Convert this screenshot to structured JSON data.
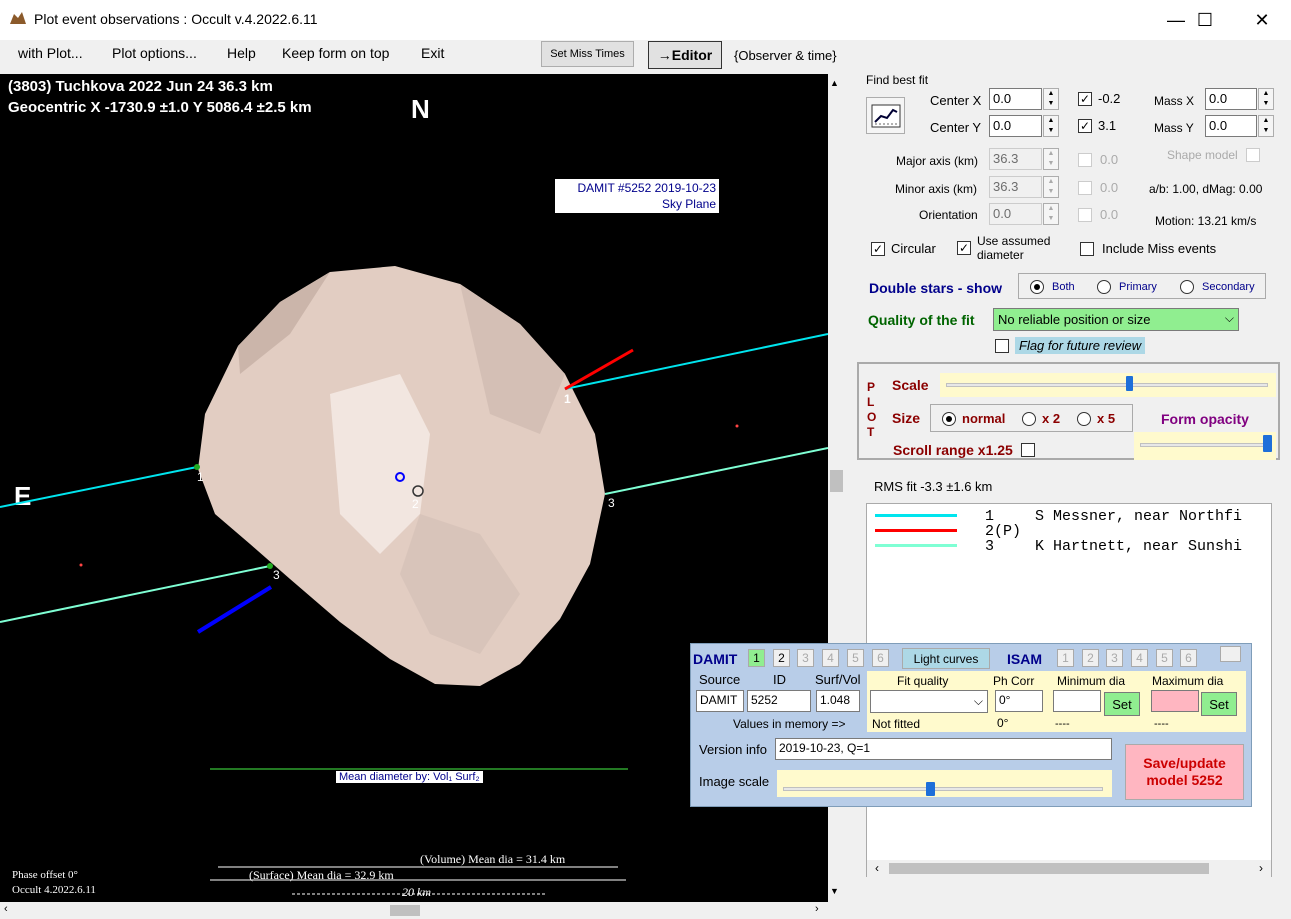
{
  "window": {
    "title": "Plot event observations : Occult v.4.2022.6.11",
    "minimize": "—",
    "maximize": "☐",
    "close": "✕"
  },
  "menu": {
    "with_plot": "with Plot...",
    "plot_options": "Plot options...",
    "help": "Help",
    "keep_on_top": "Keep form on top",
    "exit": "Exit",
    "set_miss_times": "Set Miss Times",
    "editor": "→Editor",
    "observer_time": "{Observer & time}"
  },
  "plot": {
    "header_line1": "(3803) Tuchkova  2022 Jun 24   36.3 km",
    "header_line2": "Geocentric  X  -1730.9 ±1.0  Y 5086.4 ±2.5 km",
    "north": "N",
    "east": "E",
    "damit_label": "DAMIT #5252 2019-10-23",
    "sky_plane": "Sky Plane",
    "chord_labels": [
      "1",
      "1",
      "2",
      "3",
      "3"
    ],
    "mean_diameter_by": "Mean diameter by:  Vol₁  Surf₂",
    "volume_mean": "(Volume) Mean dia = 31.4 km",
    "surface_mean": "(Surface) Mean dia = 32.9 km",
    "scale_20km": "20 km",
    "phase_offset": "Phase offset 0°",
    "version": "Occult 4.2022.6.11"
  },
  "fit": {
    "title": "Find best fit",
    "center_x_label": "Center X",
    "center_x": "0.0",
    "center_y_label": "Center Y",
    "center_y": "0.0",
    "chk_x_val": "-0.2",
    "chk_y_val": "3.1",
    "mass_x_label": "Mass X",
    "mass_x": "0.0",
    "mass_y_label": "Mass Y",
    "mass_y": "0.0",
    "major_label": "Major axis (km)",
    "major": "36.3",
    "minor_label": "Minor axis (km)",
    "minor": "36.3",
    "orient_label": "Orientation",
    "orient": "0.0",
    "zero1": "0.0",
    "zero2": "0.0",
    "zero3": "0.0",
    "shape_model": "Shape model",
    "ab_dmag": "a/b: 1.00, dMag: 0.00",
    "motion": "Motion: 13.21 km/s",
    "circular": "Circular",
    "use_assumed": "Use assumed diameter",
    "include_miss": "Include Miss events",
    "double_stars": "Double stars - show",
    "both": "Both",
    "primary": "Primary",
    "secondary": "Secondary",
    "quality_label": "Quality of the fit",
    "quality_value": "No reliable position or size",
    "flag_review": "Flag for future review"
  },
  "plotpanel": {
    "side_label": [
      "P",
      "L",
      "O",
      "T"
    ],
    "scale": "Scale",
    "size": "Size",
    "normal": "normal",
    "x2": "x 2",
    "x5": "x 5",
    "form_opacity": "Form opacity",
    "scroll_range": "Scroll range x1.25",
    "scale_level": 0.57,
    "opacity_level": 0.98
  },
  "rms": "RMS fit -3.3 ±1.6 km",
  "legend": [
    {
      "num": "1",
      "name": "S Messner, near Northfi",
      "color": "#00e5ee"
    },
    {
      "num": "2(P)",
      "name": "",
      "color": "#ff0000"
    },
    {
      "num": "3",
      "name": "K Hartnett, near Sunshi",
      "color": "#7fffd4"
    }
  ],
  "damit": {
    "title": "DAMIT",
    "tabs": [
      "1",
      "2",
      "3",
      "4",
      "5",
      "6"
    ],
    "light_curves": "Light curves",
    "isam": "ISAM",
    "isam_tabs": [
      "1",
      "2",
      "3",
      "4",
      "5",
      "6"
    ],
    "source_label": "Source",
    "id_label": "ID",
    "surfvol_label": "Surf/Vol",
    "source": "DAMIT",
    "id": "5252",
    "surfvol": "1.048",
    "fit_quality": "Fit quality",
    "ph_corr": "Ph Corr",
    "ph_corr_val": "0°",
    "min_dia": "Minimum dia",
    "max_dia": "Maximum dia",
    "set": "Set",
    "values_in_memory": "Values in memory =>",
    "not_fitted": "Not fitted",
    "mem_ph": "0°",
    "mem_min": "----",
    "mem_max": "----",
    "version_label": "Version info",
    "version_val": "2019-10-23, Q=1",
    "image_scale": "Image scale",
    "save_update": "Save/update model 5252",
    "image_scale_level": 0.46
  }
}
